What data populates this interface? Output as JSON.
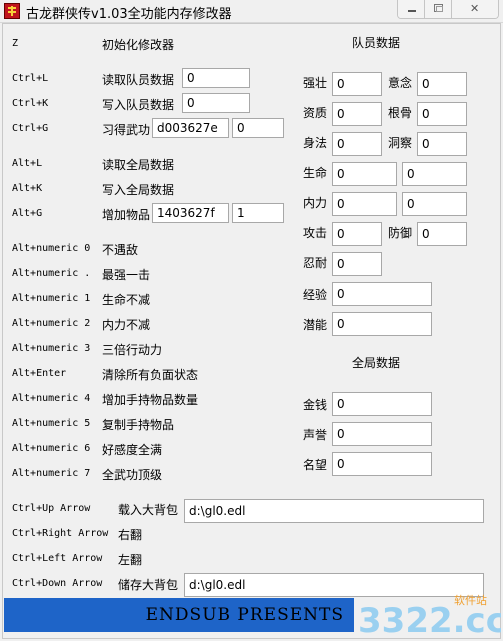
{
  "window": {
    "title": "古龙群侠传v1.03全功能内存修改器"
  },
  "hotkeys": [
    {
      "key": "Z",
      "label": "初始化修改器"
    },
    {
      "key": "Ctrl+L",
      "label": "读取队员数据",
      "value": "0"
    },
    {
      "key": "Ctrl+K",
      "label": "写入队员数据",
      "value": "0"
    },
    {
      "key": "Ctrl+G",
      "label": "习得武功",
      "value": "d003627e",
      "value2": "0"
    },
    {
      "key": "Alt+L",
      "label": "读取全局数据"
    },
    {
      "key": "Alt+K",
      "label": "写入全局数据"
    },
    {
      "key": "Alt+G",
      "label": "增加物品",
      "value": "1403627f",
      "value2": "1"
    },
    {
      "key": "Alt+numeric 0",
      "label": "不遇敌"
    },
    {
      "key": "Alt+numeric .",
      "label": "最强一击"
    },
    {
      "key": "Alt+numeric 1",
      "label": "生命不减"
    },
    {
      "key": "Alt+numeric 2",
      "label": "内力不减"
    },
    {
      "key": "Alt+numeric 3",
      "label": "三倍行动力"
    },
    {
      "key": "Alt+Enter",
      "label": "清除所有负面状态"
    },
    {
      "key": "Alt+numeric 4",
      "label": "增加手持物品数量"
    },
    {
      "key": "Alt+numeric 5",
      "label": "复制手持物品"
    },
    {
      "key": "Alt+numeric 6",
      "label": "好感度全满"
    },
    {
      "key": "Alt+numeric 7",
      "label": "全武功顶级"
    },
    {
      "key": "Ctrl+Up Arrow",
      "label": "载入大背包",
      "value": "d:\\gl0.edl"
    },
    {
      "key": "Ctrl+Right Arrow",
      "label": "右翻"
    },
    {
      "key": "Ctrl+Left Arrow",
      "label": "左翻"
    },
    {
      "key": "Ctrl+Down Arrow",
      "label": "储存大背包",
      "value": "d:\\gl0.edl"
    }
  ],
  "member": {
    "title": "队员数据",
    "fields": [
      {
        "label": "强壮",
        "value": "0"
      },
      {
        "label": "意念",
        "value": "0"
      },
      {
        "label": "资质",
        "value": "0"
      },
      {
        "label": "根骨",
        "value": "0"
      },
      {
        "label": "身法",
        "value": "0"
      },
      {
        "label": "洞察",
        "value": "0"
      },
      {
        "label": "生命",
        "value": "0",
        "value2": "0"
      },
      {
        "label": "内力",
        "value": "0",
        "value2": "0"
      },
      {
        "label": "攻击",
        "value": "0"
      },
      {
        "label": "防御",
        "value": "0"
      },
      {
        "label": "忍耐",
        "value": "0"
      },
      {
        "label": "经验",
        "value": "0"
      },
      {
        "label": "潜能",
        "value": "0"
      }
    ]
  },
  "global": {
    "title": "全局数据",
    "fields": [
      {
        "label": "金钱",
        "value": "0"
      },
      {
        "label": "声誉",
        "value": "0"
      },
      {
        "label": "名望",
        "value": "0"
      }
    ]
  },
  "footer": {
    "text": "ENDSUB PRESENTS"
  },
  "watermark": {
    "brand": "3322.cc",
    "tag": "软件站"
  }
}
